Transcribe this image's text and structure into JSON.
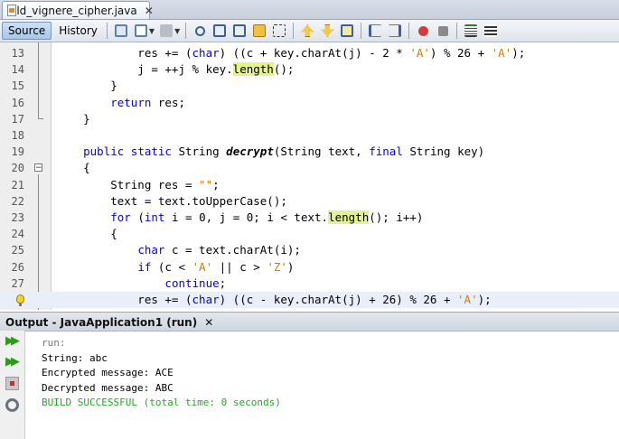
{
  "file_tab": {
    "label": "old_vignere_cipher.java",
    "close": "✕"
  },
  "toolbar": {
    "source_label": "Source",
    "history_label": "History"
  },
  "editor": {
    "lines": [
      {
        "n": "13",
        "segs": [
          [
            "n",
            "            res += ("
          ],
          [
            "kw",
            "char"
          ],
          [
            "n",
            ") ((c + key.charAt(j) - 2 * "
          ],
          [
            "str",
            "'A'"
          ],
          [
            "n",
            ") % 26 + "
          ],
          [
            "str",
            "'A'"
          ],
          [
            "n",
            ");"
          ]
        ]
      },
      {
        "n": "14",
        "segs": [
          [
            "n",
            "            j = ++j % key."
          ],
          [
            "hl",
            "length"
          ],
          [
            "n",
            "();"
          ]
        ]
      },
      {
        "n": "15",
        "segs": [
          [
            "n",
            "        }"
          ]
        ]
      },
      {
        "n": "16",
        "segs": [
          [
            "n",
            "        "
          ],
          [
            "kw",
            "return"
          ],
          [
            "n",
            " res;"
          ]
        ]
      },
      {
        "n": "17",
        "segs": [
          [
            "n",
            "    }"
          ]
        ]
      },
      {
        "n": "18",
        "segs": []
      },
      {
        "n": "19",
        "segs": [
          [
            "n",
            "    "
          ],
          [
            "kw",
            "public"
          ],
          [
            "n",
            " "
          ],
          [
            "kw",
            "static"
          ],
          [
            "n",
            " String "
          ],
          [
            "it",
            "decrypt"
          ],
          [
            "n",
            "(String text, "
          ],
          [
            "kw",
            "final"
          ],
          [
            "n",
            " String key)"
          ]
        ]
      },
      {
        "n": "20",
        "segs": [
          [
            "n",
            "    {"
          ]
        ]
      },
      {
        "n": "21",
        "segs": [
          [
            "n",
            "        String res = "
          ],
          [
            "str",
            "\"\""
          ],
          [
            "n",
            ";"
          ]
        ]
      },
      {
        "n": "22",
        "segs": [
          [
            "n",
            "        text = text.toUpperCase();"
          ]
        ]
      },
      {
        "n": "23",
        "segs": [
          [
            "n",
            "        "
          ],
          [
            "kw",
            "for"
          ],
          [
            "n",
            " ("
          ],
          [
            "kw",
            "int"
          ],
          [
            "n",
            " i = 0, j = 0; i < text."
          ],
          [
            "hl",
            "length"
          ],
          [
            "n",
            "(); i++)"
          ]
        ]
      },
      {
        "n": "24",
        "segs": [
          [
            "n",
            "        {"
          ]
        ]
      },
      {
        "n": "25",
        "segs": [
          [
            "n",
            "            "
          ],
          [
            "kw",
            "char"
          ],
          [
            "n",
            " c = text.charAt(i);"
          ]
        ]
      },
      {
        "n": "26",
        "segs": [
          [
            "n",
            "            "
          ],
          [
            "kw",
            "if"
          ],
          [
            "n",
            " (c < "
          ],
          [
            "str",
            "'A'"
          ],
          [
            "n",
            " || c > "
          ],
          [
            "str",
            "'Z'"
          ],
          [
            "n",
            ")"
          ]
        ]
      },
      {
        "n": "27",
        "segs": [
          [
            "n",
            "                "
          ],
          [
            "kw",
            "continue"
          ],
          [
            "n",
            ";"
          ]
        ]
      },
      {
        "n": "",
        "segs": [
          [
            "n",
            "            res += ("
          ],
          [
            "kw",
            "char"
          ],
          [
            "n",
            ") ((c - key.charAt(j) + 26) % 26 + "
          ],
          [
            "str",
            "'A'"
          ],
          [
            "n",
            ");"
          ]
        ]
      }
    ]
  },
  "output": {
    "tab_label": "Output - JavaApplication1 (run)",
    "close": "✕",
    "lines": [
      {
        "cls": "run",
        "text": "run:"
      },
      {
        "cls": "",
        "text": "String: abc"
      },
      {
        "cls": "",
        "text": "Encrypted message: ACE"
      },
      {
        "cls": "",
        "text": "Decrypted message: ABC"
      },
      {
        "cls": "ok",
        "text": "BUILD SUCCESSFUL (total time: 0 seconds)"
      }
    ]
  },
  "colors": {
    "keyword": "#0000e6",
    "string": "#ce7b00",
    "highlight": "#e4f28a",
    "success": "#22aa22"
  }
}
